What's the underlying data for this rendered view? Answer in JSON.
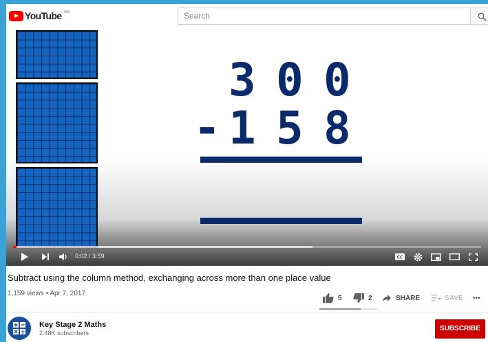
{
  "header": {
    "logo_text": "YouTube",
    "country": "GB",
    "search_placeholder": "Search"
  },
  "video": {
    "digits_top": [
      "3",
      "0",
      "0"
    ],
    "operator": "-",
    "digits_bottom": [
      "1",
      "5",
      "8"
    ],
    "time": "0:02 / 3:59",
    "progress_fraction": 0.008,
    "buffered_fraction": 0.64
  },
  "info": {
    "title": "Subtract using the column method, exchanging across more than one place value",
    "meta": "1,159 views • Apr 7, 2017",
    "likes": "5",
    "dislikes": "2",
    "share_label": "SHARE",
    "save_label": "SAVE",
    "more_label": "•••"
  },
  "channel": {
    "name": "Key Stage 2 Maths",
    "subscribers": "2.48K subscribers",
    "subscribe_label": "SUBSCRIBE"
  },
  "colors": {
    "brand_red": "#ff0000",
    "subscribe_red": "#cc0000",
    "digit_blue": "#0b2a6b",
    "block_blue": "#1565c0",
    "background": "#3aa3d6"
  }
}
